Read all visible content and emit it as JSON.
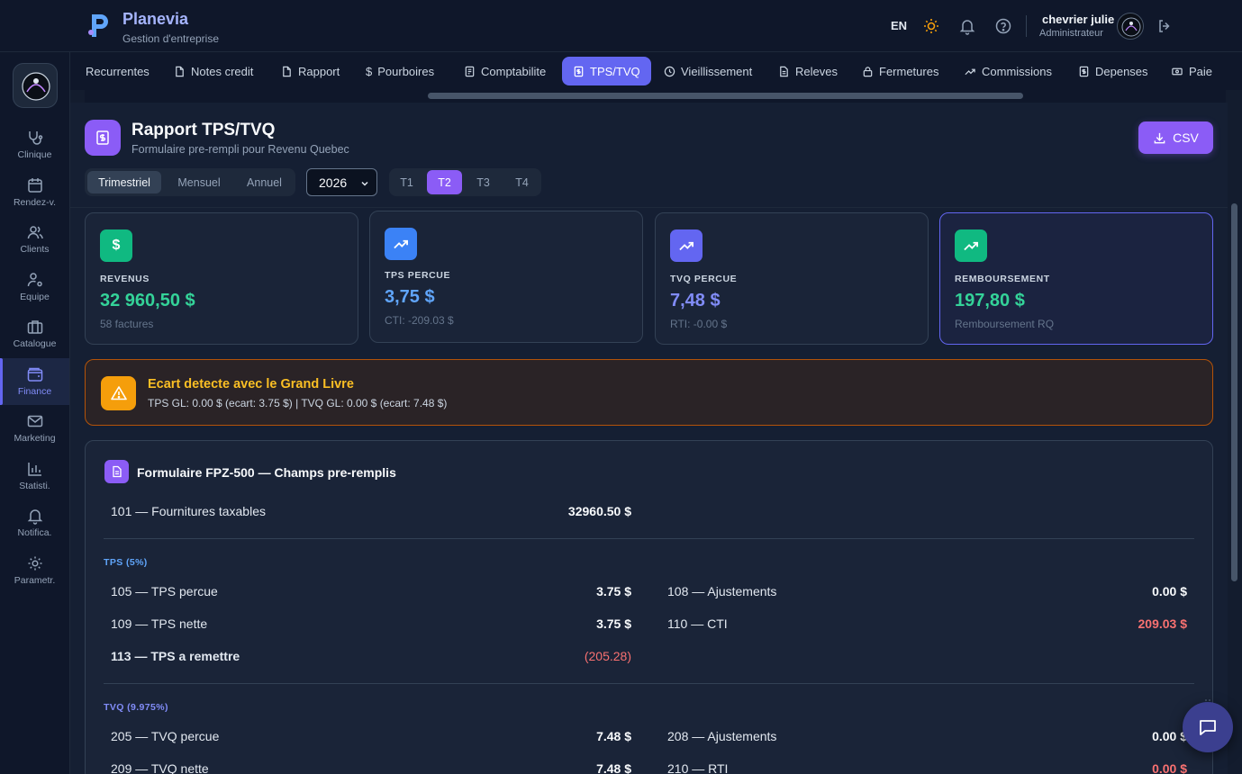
{
  "header": {
    "brand_name": "Planevia",
    "brand_subtitle": "Gestion d'entreprise",
    "language": "EN",
    "user_name": "chevrier julie",
    "user_role": "Administrateur"
  },
  "sidebar": {
    "items": [
      {
        "label": "Clinique",
        "icon": "stethoscope-icon"
      },
      {
        "label": "Rendez-v.",
        "icon": "calendar-icon"
      },
      {
        "label": "Clients",
        "icon": "users-icon"
      },
      {
        "label": "Equipe",
        "icon": "user-cog-icon"
      },
      {
        "label": "Catalogue",
        "icon": "briefcase-icon"
      },
      {
        "label": "Finance",
        "icon": "wallet-icon",
        "active": true
      },
      {
        "label": "Marketing",
        "icon": "mail-icon"
      },
      {
        "label": "Statisti.",
        "icon": "bar-chart-icon"
      },
      {
        "label": "Notifica.",
        "icon": "bell-icon"
      },
      {
        "label": "Parametr.",
        "icon": "gear-icon"
      }
    ]
  },
  "tabs": [
    {
      "label": "Recurrentes"
    },
    {
      "label": "Notes credit",
      "icon": "file-icon"
    },
    {
      "label": "Rapport",
      "icon": "file-icon"
    },
    {
      "label": "Pourboires",
      "icon": "dollar-icon"
    },
    {
      "label": "Comptabilite",
      "icon": "ledger-icon"
    },
    {
      "label": "TPS/TVQ",
      "icon": "receipt-icon",
      "active": true
    },
    {
      "label": "Vieillissement",
      "icon": "clock-icon"
    },
    {
      "label": "Releves",
      "icon": "file-text-icon"
    },
    {
      "label": "Fermetures",
      "icon": "lock-icon"
    },
    {
      "label": "Commissions",
      "icon": "trending-up-icon"
    },
    {
      "label": "Depenses",
      "icon": "receipt-icon"
    },
    {
      "label": "Paie",
      "icon": "banknote-icon"
    }
  ],
  "report": {
    "title": "Rapport TPS/TVQ",
    "subtitle": "Formulaire pre-rempli pour Revenu Quebec",
    "csv_label": "CSV",
    "periods": [
      "Trimestriel",
      "Mensuel",
      "Annuel"
    ],
    "selected_period": "Trimestriel",
    "year": "2026",
    "quarters": [
      "T1",
      "T2",
      "T3",
      "T4"
    ],
    "selected_quarter": "T2"
  },
  "cards": [
    {
      "label": "REVENUS",
      "value": "32 960,50 $",
      "note": "58 factures",
      "color": "#34d399",
      "icon": "dollar-icon",
      "icon_bg": "#10b981"
    },
    {
      "label": "TPS PERCUE",
      "value": "3,75 $",
      "note": "CTI: -209.03 $",
      "color": "#60a5fa",
      "icon": "trending-up-icon",
      "icon_bg": "#3b82f6"
    },
    {
      "label": "TVQ PERCUE",
      "value": "7,48 $",
      "note": "RTI: -0.00 $",
      "color": "#818cf8",
      "icon": "trending-up-icon",
      "icon_bg": "#6366f1"
    },
    {
      "label": "REMBOURSEMENT",
      "value": "197,80 $",
      "note": "Remboursement RQ",
      "color": "#34d399",
      "icon": "trending-up-icon",
      "icon_bg": "#10b981"
    }
  ],
  "warning": {
    "title": "Ecart detecte avec le Grand Livre",
    "text": "TPS GL: 0.00 $ (ecart: 3.75 $) | TVQ GL: 0.00 $ (ecart: 7.48 $)"
  },
  "form": {
    "title": "Formulaire FPZ-500 — Champs pre-remplis",
    "line101": {
      "label": "101 — Fournitures taxables",
      "value": "32960.50 $"
    },
    "tps_section": "TPS (5%)",
    "tps_rows": [
      {
        "label": "105 — TPS percue",
        "value": "3.75 $"
      },
      {
        "label": "108 — Ajustements",
        "value": "0.00 $"
      },
      {
        "label": "109 — TPS nette",
        "value": "3.75 $"
      },
      {
        "label": "110 — CTI",
        "value": "209.03 $"
      },
      {
        "label": "113 — TPS a remettre",
        "value": "(205.28)"
      }
    ],
    "tvq_section": "TVQ (9.975%)",
    "tvq_rows": [
      {
        "label": "205 — TVQ percue",
        "value": "7.48 $"
      },
      {
        "label": "208 — Ajustements",
        "value": "0.00 $"
      },
      {
        "label": "209 — TVQ nette",
        "value": "7.48 $"
      },
      {
        "label": "210 — RTI",
        "value": "0.00 $"
      }
    ]
  }
}
